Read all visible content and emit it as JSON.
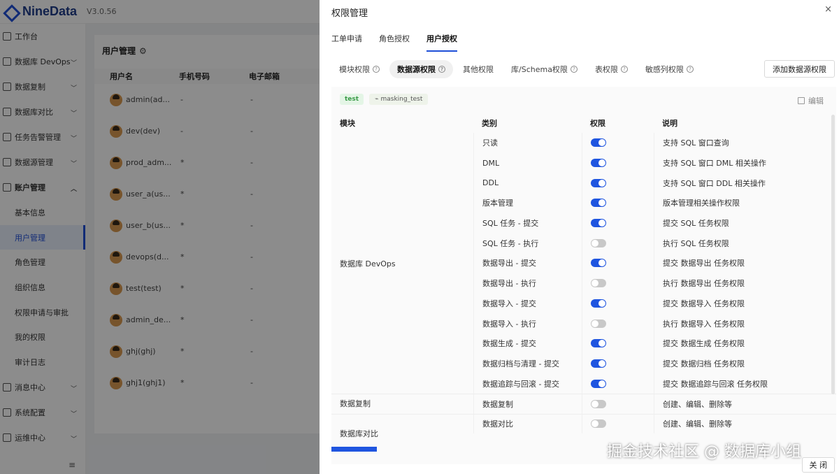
{
  "app": {
    "logo_text": "NineData",
    "version": "V3.0.56"
  },
  "sidebar": {
    "items": [
      {
        "label": "工作台",
        "chevron": false,
        "icon": "home-icon"
      },
      {
        "label": "数据库 DevOps",
        "chevron": true,
        "icon": "devops-icon"
      },
      {
        "label": "数据复制",
        "chevron": true,
        "icon": "copy-icon"
      },
      {
        "label": "数据库对比",
        "chevron": true,
        "icon": "compare-icon"
      },
      {
        "label": "任务告警管理",
        "chevron": true,
        "icon": "alarm-icon"
      },
      {
        "label": "数据源管理",
        "chevron": true,
        "icon": "datasource-icon"
      },
      {
        "label": "账户管理",
        "chevron": true,
        "icon": "account-icon",
        "expanded": true
      }
    ],
    "sub_items": [
      "基本信息",
      "用户管理",
      "角色管理",
      "组织信息",
      "权限申请与审批",
      "我的权限",
      "审计日志"
    ],
    "active_sub": "用户管理",
    "bottom_items": [
      {
        "label": "消息中心",
        "icon": "message-icon"
      },
      {
        "label": "系统配置",
        "icon": "settings-grid-icon"
      },
      {
        "label": "运维中心",
        "icon": "wrench-icon"
      }
    ],
    "collapse_glyph": "≡"
  },
  "user_page": {
    "title": "用户管理",
    "columns": [
      "用户名",
      "手机号码",
      "电子邮箱"
    ],
    "rows": [
      {
        "name": "admin(ad...",
        "phone": "-",
        "email": "-"
      },
      {
        "name": "dev(dev)",
        "phone": "-",
        "email": "-"
      },
      {
        "name": "prod_adm...",
        "phone": "*",
        "email": "-"
      },
      {
        "name": "user_a(us...",
        "phone": "*",
        "email": "-"
      },
      {
        "name": "user_b(us...",
        "phone": "*",
        "email": "-"
      },
      {
        "name": "devops(d...",
        "phone": "*",
        "email": "-"
      },
      {
        "name": "test(test)",
        "phone": "*",
        "email": "-"
      },
      {
        "name": "admin_de...",
        "phone": "*",
        "email": "-"
      },
      {
        "name": "ghj(ghj)",
        "phone": "*",
        "email": "-"
      },
      {
        "name": "ghj1(ghj1)",
        "phone": "*",
        "email": "-"
      }
    ]
  },
  "drawer": {
    "title": "权限管理",
    "close_glyph": "×",
    "tabs": [
      "工单申请",
      "角色授权",
      "用户授权"
    ],
    "active_tab": "用户授权",
    "subtabs": [
      {
        "label": "模块权限",
        "help": true
      },
      {
        "label": "数据源权限",
        "help": true,
        "active": true
      },
      {
        "label": "其他权限",
        "help": false
      },
      {
        "label": "库/Schema权限",
        "help": true
      },
      {
        "label": "表权限",
        "help": true
      },
      {
        "label": "敏感列权限",
        "help": true
      }
    ],
    "help_glyph": "?",
    "add_button": "添加数据源权限",
    "env_tag": "test",
    "db_tag": "masking_test",
    "edit_label": "编辑",
    "table": {
      "headers": [
        "模块",
        "类别",
        "权限",
        "说明"
      ],
      "groups": [
        {
          "module": "数据库 DevOps",
          "rows": [
            {
              "category": "只读",
              "enabled": true,
              "desc": "支持 SQL 窗口查询"
            },
            {
              "category": "DML",
              "enabled": true,
              "desc": "支持 SQL 窗口 DML 相关操作"
            },
            {
              "category": "DDL",
              "enabled": true,
              "desc": "支持 SQL 窗口 DDL 相关操作"
            },
            {
              "category": "版本管理",
              "enabled": true,
              "desc": "版本管理相关操作权限"
            },
            {
              "category": "SQL 任务 - 提交",
              "enabled": true,
              "desc": "提交 SQL 任务权限"
            },
            {
              "category": "SQL 任务 - 执行",
              "enabled": false,
              "desc": "执行 SQL 任务权限"
            },
            {
              "category": "数据导出 - 提交",
              "enabled": true,
              "desc": "提交 数据导出 任务权限"
            },
            {
              "category": "数据导出 - 执行",
              "enabled": false,
              "desc": "执行 数据导出 任务权限"
            },
            {
              "category": "数据导入 - 提交",
              "enabled": true,
              "desc": "提交 数据导入 任务权限"
            },
            {
              "category": "数据导入 - 执行",
              "enabled": false,
              "desc": "执行 数据导入 任务权限"
            },
            {
              "category": "数据生成 - 提交",
              "enabled": true,
              "desc": "提交 数据生成 任务权限"
            },
            {
              "category": "数据归档与清理 - 提交",
              "enabled": true,
              "desc": "提交 数据归档 任务权限"
            },
            {
              "category": "数据追踪与回滚 - 提交",
              "enabled": true,
              "desc": "提交 数据追踪与回滚 任务权限"
            }
          ]
        },
        {
          "module": "数据复制",
          "rows": [
            {
              "category": "数据复制",
              "enabled": false,
              "desc": "创建、编辑、删除等"
            }
          ]
        },
        {
          "module": "数据库对比",
          "rows": [
            {
              "category": "数据对比",
              "enabled": false,
              "desc": "创建、编辑、删除等"
            }
          ]
        }
      ]
    },
    "close_button": "关 闭"
  },
  "watermark": "掘金技术社区 @ 数据库小组",
  "colors": {
    "accent": "#1f55e0",
    "env_tag_bg": "#e4f5e6",
    "env_tag_text": "#3a9b48",
    "toggle_off": "#c8c8c8"
  }
}
